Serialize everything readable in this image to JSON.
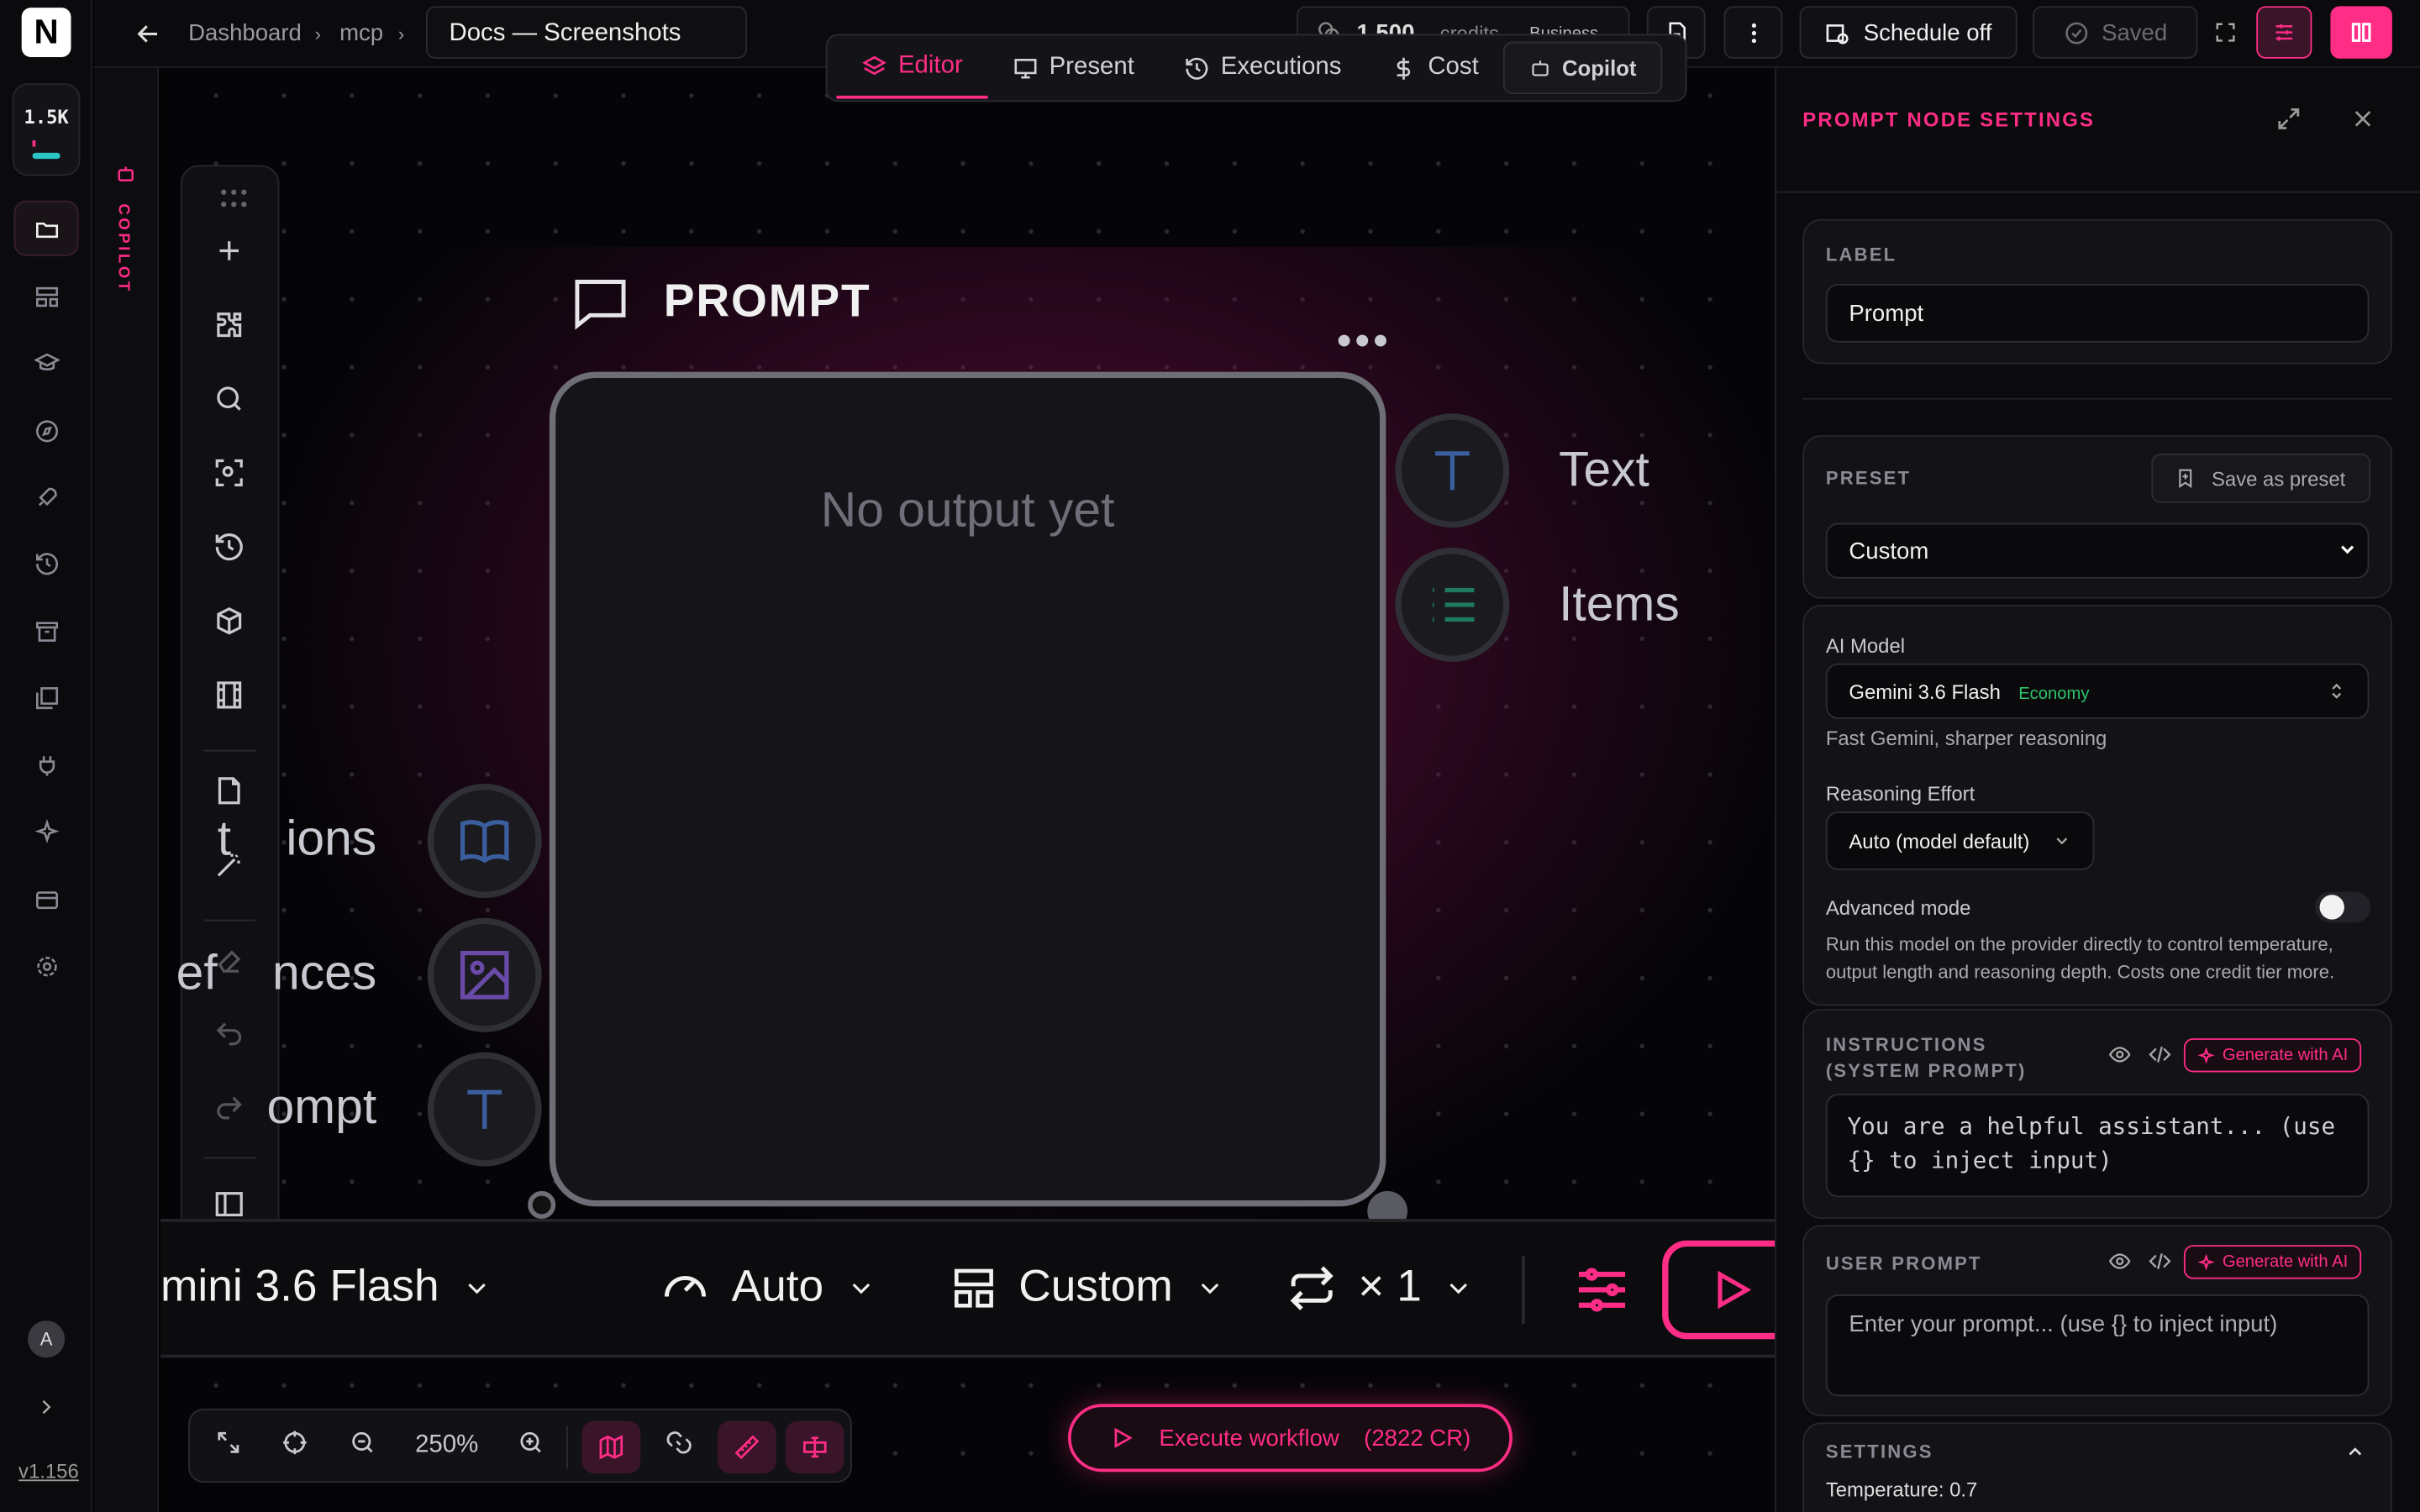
{
  "app": {
    "logo_text": "N",
    "credits_short": "1.5K",
    "version": "v1.156",
    "avatar_initial": "A",
    "accent": "#ff2d86"
  },
  "breadcrumb": {
    "items": [
      "Dashboard",
      "mcp"
    ],
    "doc_title": "Docs — Screenshots"
  },
  "topbar": {
    "credits": "1,500",
    "credits_label": "credits",
    "plan": "Business",
    "schedule_label": "Schedule off",
    "saved_label": "Saved"
  },
  "tabs": [
    {
      "label": "Editor",
      "icon": "layers-icon",
      "active": true
    },
    {
      "label": "Present",
      "icon": "monitor-icon"
    },
    {
      "label": "Executions",
      "icon": "history-icon"
    },
    {
      "label": "Cost",
      "icon": "dollar-icon"
    },
    {
      "label": "Copilot",
      "icon": "bot-icon"
    }
  ],
  "copilot_strip": {
    "label": "COPILOT"
  },
  "node": {
    "title": "PROMPT",
    "empty_text": "No output yet",
    "outputs": [
      "Text",
      "Items"
    ],
    "inputs": [
      "Instructions",
      "References",
      "Prompt"
    ],
    "input_visible": [
      "t    ions",
      "ef    nces",
      "ompt"
    ]
  },
  "node_toolbar": {
    "model": "mini 3.6 Flash",
    "effort": "Auto",
    "preset": "Custom",
    "repeat": "× 1"
  },
  "zoom": {
    "level": "250%"
  },
  "execute": {
    "label": "Execute workflow",
    "cost": "(2822 CR)"
  },
  "panel": {
    "title": "PROMPT NODE SETTINGS",
    "label_caption": "LABEL",
    "label_value": "Prompt",
    "preset_caption": "PRESET",
    "save_preset": "Save as preset",
    "preset_value": "Custom",
    "ai_model_caption": "AI Model",
    "ai_model": "Gemini 3.6 Flash",
    "ai_model_tier": "Economy",
    "ai_model_desc": "Fast Gemini, sharper reasoning",
    "reasoning_caption": "Reasoning Effort",
    "reasoning_value": "Auto (model default)",
    "advanced_caption": "Advanced mode",
    "advanced_desc": "Run this model on the provider directly to control temperature, output length and reasoning depth. Costs one credit tier more.",
    "instructions_caption": "INSTRUCTIONS (SYSTEM PROMPT)",
    "instructions_placeholder": "You are a helpful assistant... (use {} to inject input)",
    "generate_label": "Generate with AI",
    "user_prompt_caption": "USER PROMPT",
    "user_prompt_placeholder": "Enter your prompt... (use {} to inject input)",
    "settings_caption": "SETTINGS",
    "temperature": "Temperature: 0.7"
  }
}
